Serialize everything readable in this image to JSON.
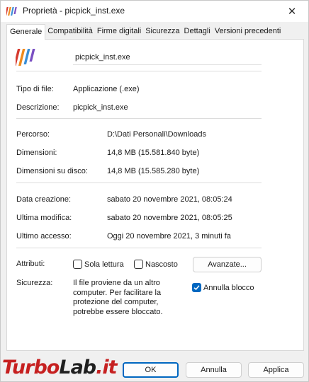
{
  "window": {
    "title": "Proprietà - picpick_inst.exe",
    "close_symbol": "✕"
  },
  "tabs": [
    {
      "label": "Generale",
      "active": true
    },
    {
      "label": "Compatibilità"
    },
    {
      "label": "Firme digitali"
    },
    {
      "label": "Sicurezza"
    },
    {
      "label": "Dettagli"
    },
    {
      "label": "Versioni precedenti"
    }
  ],
  "general": {
    "file_name": "picpick_inst.exe",
    "file_type_label": "Tipo di file:",
    "file_type_value": "Applicazione (.exe)",
    "description_label": "Descrizione:",
    "description_value": "picpick_inst.exe",
    "location_label": "Percorso:",
    "location_value": "D:\\Dati Personali\\Downloads",
    "size_label": "Dimensioni:",
    "size_value": "14,8 MB (15.581.840 byte)",
    "size_on_disk_label": "Dimensioni su disco:",
    "size_on_disk_value": "14,8 MB (15.585.280 byte)",
    "created_label": "Data creazione:",
    "created_value": "sabato 20 novembre 2021, 08:05:24",
    "modified_label": "Ultima modifica:",
    "modified_value": "sabato 20 novembre 2021, 08:05:25",
    "accessed_label": "Ultimo accesso:",
    "accessed_value": "Oggi 20 novembre 2021, 3 minuti fa",
    "attributes_label": "Attributi:",
    "readonly_label": "Sola lettura",
    "readonly_checked": false,
    "hidden_label": "Nascosto",
    "hidden_checked": false,
    "advanced_button": "Avanzate...",
    "security_label": "Sicurezza:",
    "security_text_line1": "Il file proviene da un altro",
    "security_text_line2": "computer. Per facilitare la",
    "security_text_line3": "protezione del computer,",
    "security_text_line4": "potrebbe essere bloccato.",
    "unblock_label": "Annulla blocco",
    "unblock_checked": true
  },
  "footer": {
    "ok": "OK",
    "cancel": "Annulla",
    "apply": "Applica"
  },
  "watermark": {
    "part1": "Turbo",
    "part2": "Lab",
    "part3": ".it"
  },
  "colors": {
    "accent": "#0067c0",
    "watermark_red": "#c62020"
  }
}
